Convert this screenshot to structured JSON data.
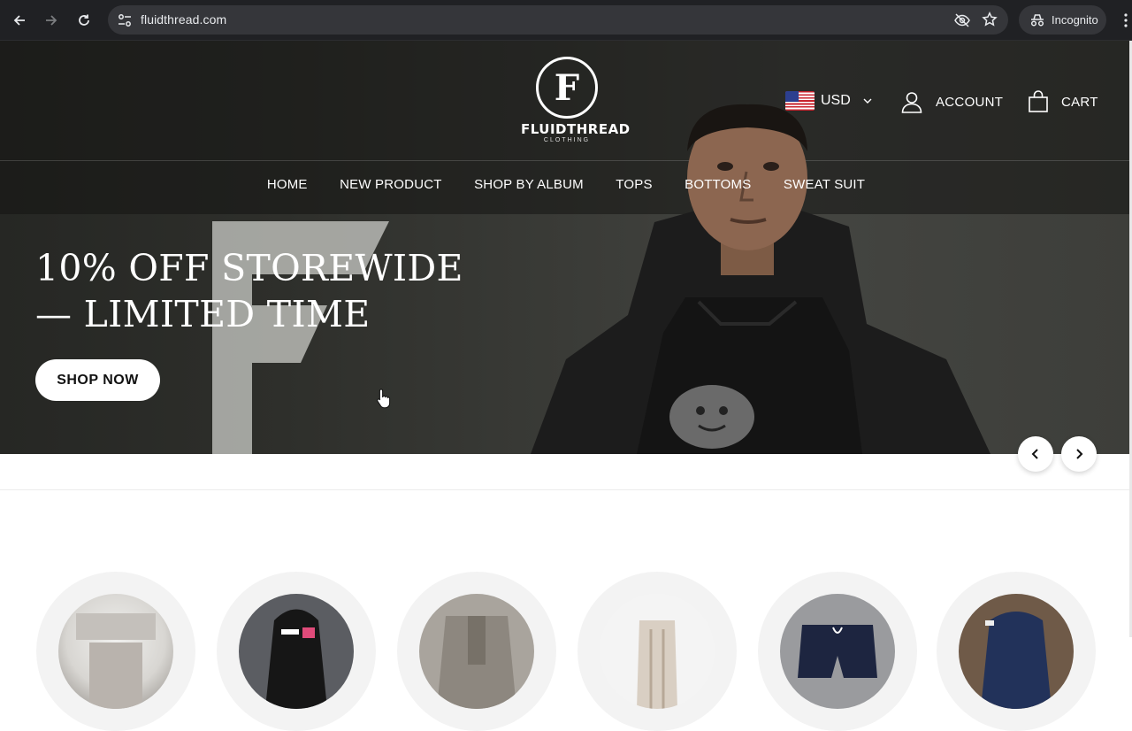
{
  "browser": {
    "url": "fluidthread.com",
    "mode_label": "Incognito"
  },
  "logo": {
    "letter": "F",
    "brand": "FLUIDTHREAD",
    "sub": "CLOTHING"
  },
  "header": {
    "currency": "USD",
    "account_label": "ACCOUNT",
    "cart_label": "CART"
  },
  "nav": {
    "items": [
      {
        "label": "HOME"
      },
      {
        "label": "NEW PRODUCT"
      },
      {
        "label": "SHOP BY ALBUM"
      },
      {
        "label": "TOPS"
      },
      {
        "label": "BOTTOMS"
      },
      {
        "label": "SWEAT SUIT"
      }
    ]
  },
  "hero": {
    "headline_line1": "10% OFF STOREWIDE",
    "headline_line2": "— LIMITED TIME",
    "cta_label": "SHOP NOW"
  },
  "colors": {
    "hero_bg": "#2e2f2b",
    "chrome_bg": "#202124",
    "cta_bg": "#ffffff"
  },
  "categories": [
    {
      "icon": "graphic-tee-thumbnail"
    },
    {
      "icon": "black-hoodie-thumbnail"
    },
    {
      "icon": "denim-set-thumbnail"
    },
    {
      "icon": "tan-pants-thumbnail"
    },
    {
      "icon": "shorts-thumbnail"
    },
    {
      "icon": "navy-sweatsuit-thumbnail"
    }
  ]
}
